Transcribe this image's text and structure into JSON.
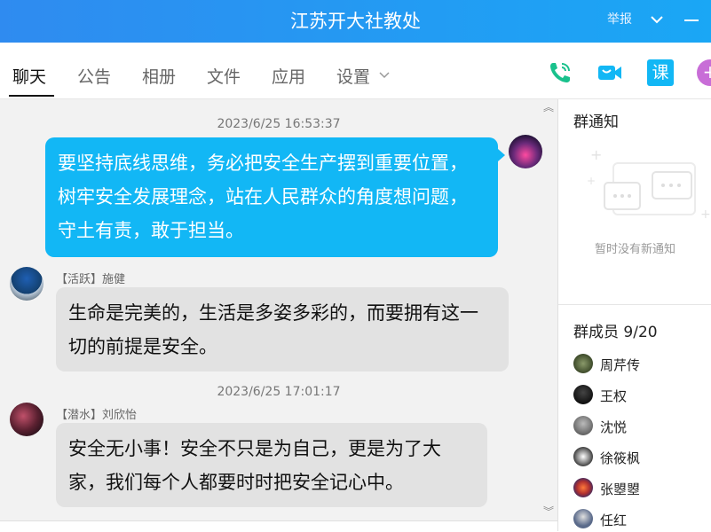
{
  "window": {
    "title": "江苏开大社教处",
    "report_label": "举报"
  },
  "tabs": [
    {
      "label": "聊天",
      "active": true
    },
    {
      "label": "公告"
    },
    {
      "label": "相册"
    },
    {
      "label": "文件"
    },
    {
      "label": "应用"
    },
    {
      "label": "设置"
    }
  ],
  "toolbar_icons": [
    "phone-icon",
    "video-call-icon",
    "course-icon",
    "more-icon"
  ],
  "toolbar": {
    "course_label": "课"
  },
  "chat": {
    "messages": [
      {
        "timestamp": "2023/6/25 16:53:37",
        "outgoing": true,
        "text": "要坚持底线思维，务必把安全生产摆到重要位置，树牢安全发展理念，站在人民群众的角度想问题，守土有责，敢于担当。"
      },
      {
        "badge": "【活跃】",
        "sender": "施健",
        "text": "生命是完美的，生活是多姿多彩的，而要拥有这一切的前提是安全。"
      },
      {
        "timestamp": "2023/6/25 17:01:17",
        "badge": "【潜水】",
        "sender": "刘欣怡",
        "text": "安全无小事！安全不只是为自己，更是为了大家，我们每个人都要时时把安全记心中。"
      }
    ]
  },
  "group_notice": {
    "title": "群通知",
    "empty_text": "暂时没有新通知"
  },
  "members": {
    "title": "群成员 9/20",
    "list": [
      "周芹传",
      "王权",
      "沈悦",
      "徐筱枫",
      "张曌曌",
      "任红"
    ]
  },
  "colors": {
    "titlebar": "#1aa7f5",
    "outgoing_bubble": "#12b7f5",
    "incoming_bubble": "#e2e2e2",
    "chat_background": "#f2f2f2",
    "phone_icon": "#19c18c",
    "video_icon": "#12b7f5",
    "course_icon": "#12b7f5",
    "more_icon": "#c86dd7"
  }
}
